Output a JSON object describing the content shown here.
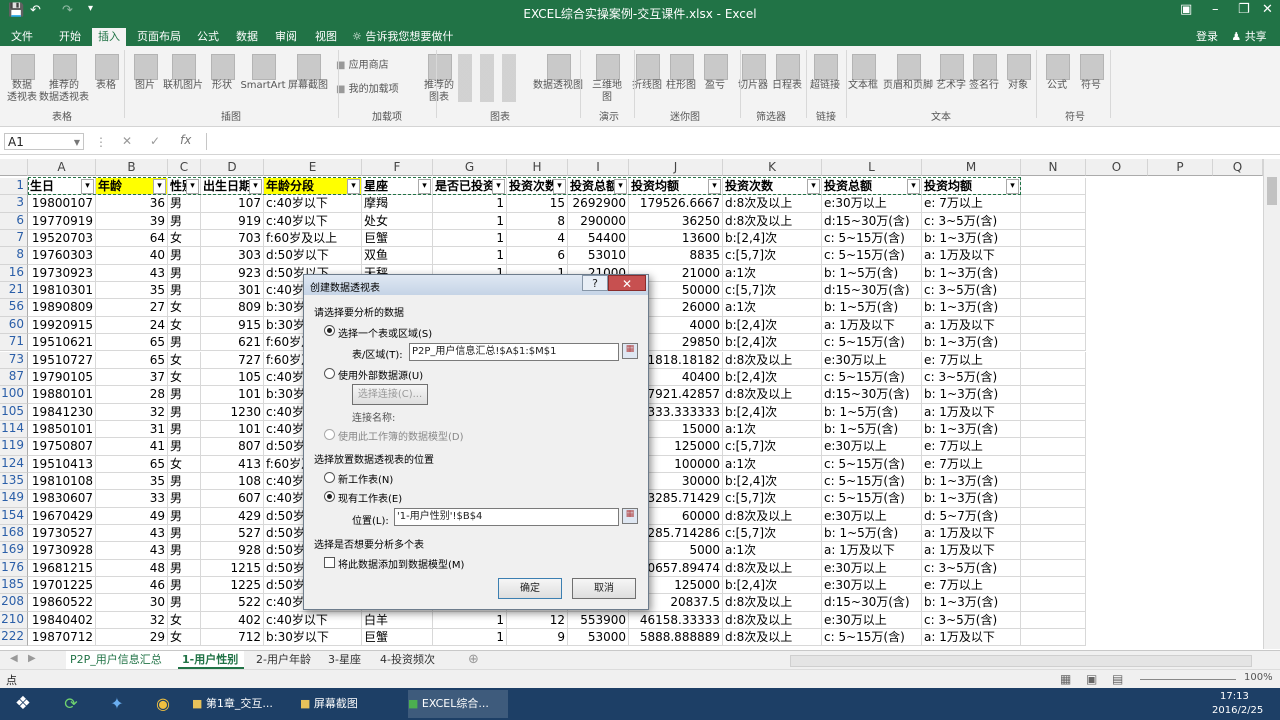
{
  "window": {
    "title": "EXCEL综合实操案例-交互课件.xlsx - Excel",
    "qat_save_icon": "save-icon",
    "qat_undo_icon": "undo-icon",
    "qat_redo_icon": "redo-icon"
  },
  "tabs": [
    "文件",
    "开始",
    "插入",
    "页面布局",
    "公式",
    "数据",
    "审阅",
    "视图"
  ],
  "active_tab": "插入",
  "tell_me": "告诉我您想要做什么...",
  "login": "登录",
  "share": "共享",
  "ribbon": {
    "buttons": [
      "数据\n透视表",
      "推荐的\n数据透视表",
      "表格",
      "图片",
      "联机图片",
      "形状",
      "SmartArt",
      "屏幕截图",
      "应用商店",
      "我的加载项",
      "推荐的\n图表",
      "数据透视图",
      "三维地\n图",
      "折线图",
      "柱形图",
      "盈亏",
      "切片器",
      "日程表",
      "超链接",
      "文本框",
      "页眉和页脚",
      "艺术字",
      "签名行",
      "对象",
      "公式",
      "符号"
    ],
    "groups": [
      "表格",
      "插图",
      "加载项",
      "图表",
      "演示",
      "迷你图",
      "筛选器",
      "链接",
      "文本",
      "符号"
    ]
  },
  "formula_bar": {
    "name_box": "A1",
    "fx": "fx",
    "value": ""
  },
  "columns": [
    "A",
    "B",
    "C",
    "D",
    "E",
    "F",
    "G",
    "H",
    "I",
    "J",
    "K",
    "L",
    "M",
    "N",
    "O",
    "P",
    "Q"
  ],
  "header_row": {
    "row": "1",
    "cells": [
      "生日",
      "年龄",
      "性别",
      "出生日期",
      "年龄分段",
      "星座",
      "是否已投资",
      "投资次数",
      "投资总额",
      "投资均额",
      "投资次数",
      "投资总额",
      "投资均额"
    ]
  },
  "rows": [
    {
      "row": "3",
      "cells": [
        "19800107",
        "36",
        "男",
        "107",
        "c:40岁以下",
        "摩羯",
        "1",
        "15",
        "2692900",
        "179526.6667",
        "d:8次及以上",
        "e:30万以上",
        "e: 7万以上"
      ]
    },
    {
      "row": "6",
      "cells": [
        "19770919",
        "39",
        "男",
        "919",
        "c:40岁以下",
        "处女",
        "1",
        "8",
        "290000",
        "36250",
        "d:8次及以上",
        "d:15~30万(含)",
        "c: 3~5万(含)"
      ]
    },
    {
      "row": "7",
      "cells": [
        "19520703",
        "64",
        "女",
        "703",
        "f:60岁及以上",
        "巨蟹",
        "1",
        "4",
        "54400",
        "13600",
        "b:[2,4]次",
        "c: 5~15万(含)",
        "b: 1~3万(含)"
      ]
    },
    {
      "row": "8",
      "cells": [
        "19760303",
        "40",
        "男",
        "303",
        "d:50岁以下",
        "双鱼",
        "1",
        "6",
        "53010",
        "8835",
        "c:[5,7]次",
        "c: 5~15万(含)",
        "a: 1万及以下"
      ]
    },
    {
      "row": "16",
      "cells": [
        "19730923",
        "43",
        "男",
        "923",
        "d:50岁以下",
        "天秤",
        "1",
        "1",
        "21000",
        "21000",
        "a:1次",
        "b: 1~5万(含)",
        "b: 1~3万(含)"
      ]
    },
    {
      "row": "21",
      "cells": [
        "19810301",
        "35",
        "男",
        "301",
        "c:40岁以下",
        "",
        "",
        "",
        "",
        "50000",
        "c:[5,7]次",
        "d:15~30万(含)",
        "c: 3~5万(含)"
      ]
    },
    {
      "row": "56",
      "cells": [
        "19890809",
        "27",
        "女",
        "809",
        "b:30岁以下",
        "",
        "",
        "",
        "",
        "26000",
        "a:1次",
        "b: 1~5万(含)",
        "b: 1~3万(含)"
      ]
    },
    {
      "row": "60",
      "cells": [
        "19920915",
        "24",
        "女",
        "915",
        "b:30岁以下",
        "",
        "",
        "",
        "",
        "4000",
        "b:[2,4]次",
        "a: 1万及以下",
        "a: 1万及以下"
      ]
    },
    {
      "row": "71",
      "cells": [
        "19510621",
        "65",
        "男",
        "621",
        "f:60岁及以上",
        "",
        "",
        "",
        "",
        "29850",
        "b:[2,4]次",
        "c: 5~15万(含)",
        "b: 1~3万(含)"
      ]
    },
    {
      "row": "73",
      "cells": [
        "19510727",
        "65",
        "女",
        "727",
        "f:60岁及以上",
        "",
        "",
        "",
        "",
        "81818.18182",
        "d:8次及以上",
        "e:30万以上",
        "e: 7万以上"
      ]
    },
    {
      "row": "87",
      "cells": [
        "19790105",
        "37",
        "女",
        "105",
        "c:40岁以下",
        "",
        "",
        "",
        "",
        "40400",
        "b:[2,4]次",
        "c: 5~15万(含)",
        "c: 3~5万(含)"
      ]
    },
    {
      "row": "100",
      "cells": [
        "19880101",
        "28",
        "男",
        "101",
        "b:30岁以下",
        "",
        "",
        "",
        "",
        "17921.42857",
        "d:8次及以上",
        "d:15~30万(含)",
        "b: 1~3万(含)"
      ]
    },
    {
      "row": "105",
      "cells": [
        "19841230",
        "32",
        "男",
        "1230",
        "c:40岁以下",
        "",
        "",
        "",
        "",
        "9333.333333",
        "b:[2,4]次",
        "b: 1~5万(含)",
        "a: 1万及以下"
      ]
    },
    {
      "row": "114",
      "cells": [
        "19850101",
        "31",
        "男",
        "101",
        "c:40岁以下",
        "",
        "",
        "",
        "",
        "15000",
        "a:1次",
        "b: 1~5万(含)",
        "b: 1~3万(含)"
      ]
    },
    {
      "row": "119",
      "cells": [
        "19750807",
        "41",
        "男",
        "807",
        "d:50岁以下",
        "",
        "",
        "",
        "",
        "125000",
        "c:[5,7]次",
        "e:30万以上",
        "e: 7万以上"
      ]
    },
    {
      "row": "124",
      "cells": [
        "19510413",
        "65",
        "女",
        "413",
        "f:60岁及以上",
        "",
        "",
        "",
        "",
        "100000",
        "a:1次",
        "c: 5~15万(含)",
        "e: 7万以上"
      ]
    },
    {
      "row": "135",
      "cells": [
        "19810108",
        "35",
        "男",
        "108",
        "c:40岁以下",
        "",
        "",
        "",
        "",
        "30000",
        "b:[2,4]次",
        "c: 5~15万(含)",
        "b: 1~3万(含)"
      ]
    },
    {
      "row": "149",
      "cells": [
        "19830607",
        "33",
        "男",
        "607",
        "c:40岁以下",
        "",
        "",
        "",
        "",
        "3285.71429",
        "c:[5,7]次",
        "c: 5~15万(含)",
        "b: 1~3万(含)"
      ]
    },
    {
      "row": "154",
      "cells": [
        "19670429",
        "49",
        "男",
        "429",
        "d:50岁以下",
        "",
        "",
        "",
        "",
        "60000",
        "d:8次及以上",
        "e:30万以上",
        "d: 5~7万(含)"
      ]
    },
    {
      "row": "168",
      "cells": [
        "19730527",
        "43",
        "男",
        "527",
        "d:50岁以下",
        "",
        "",
        "",
        "",
        "4285.714286",
        "c:[5,7]次",
        "b: 1~5万(含)",
        "a: 1万及以下"
      ]
    },
    {
      "row": "169",
      "cells": [
        "19730928",
        "43",
        "男",
        "928",
        "d:50岁以下",
        "",
        "",
        "",
        "",
        "5000",
        "a:1次",
        "a: 1万及以下",
        "a: 1万及以下"
      ]
    },
    {
      "row": "176",
      "cells": [
        "19681215",
        "48",
        "男",
        "1215",
        "d:50岁以下",
        "",
        "",
        "",
        "",
        "30657.89474",
        "d:8次及以上",
        "e:30万以上",
        "c: 3~5万(含)"
      ]
    },
    {
      "row": "185",
      "cells": [
        "19701225",
        "46",
        "男",
        "1225",
        "d:50岁以下",
        "",
        "",
        "",
        "",
        "125000",
        "b:[2,4]次",
        "e:30万以上",
        "e: 7万以上"
      ]
    },
    {
      "row": "208",
      "cells": [
        "19860522",
        "30",
        "男",
        "522",
        "c:40岁以下",
        "",
        "",
        "",
        "",
        "20837.5",
        "d:8次及以上",
        "d:15~30万(含)",
        "b: 1~3万(含)"
      ]
    },
    {
      "row": "210",
      "cells": [
        "19840402",
        "32",
        "女",
        "402",
        "c:40岁以下",
        "白羊",
        "1",
        "12",
        "553900",
        "46158.33333",
        "d:8次及以上",
        "e:30万以上",
        "c: 3~5万(含)"
      ]
    },
    {
      "row": "222",
      "cells": [
        "19870712",
        "29",
        "女",
        "712",
        "b:30岁以下",
        "巨蟹",
        "1",
        "9",
        "53000",
        "5888.888889",
        "d:8次及以上",
        "c: 5~15万(含)",
        "a: 1万及以下"
      ]
    }
  ],
  "dialog": {
    "title": "创建数据透视表",
    "section1": "请选择要分析的数据",
    "opt_table": "选择一个表或区域(S)",
    "range_label": "表/区域(T):",
    "range_value": "P2P_用户信息汇总!$A$1:$M$1",
    "opt_external": "使用外部数据源(U)",
    "choose_conn": "选择连接(C)...",
    "conn_name": "连接名称:",
    "opt_model": "使用此工作簿的数据模型(D)",
    "section2": "选择放置数据透视表的位置",
    "opt_new": "新工作表(N)",
    "opt_existing": "现有工作表(E)",
    "location_label": "位置(L):",
    "location_value": "'1-用户性别'!$B$4",
    "section3": "选择是否想要分析多个表",
    "add_model": "将此数据添加到数据模型(M)",
    "ok": "确定",
    "cancel": "取消"
  },
  "sheets": [
    "P2P_用户信息汇总",
    "1-用户性别",
    "2-用户年龄",
    "3-星座",
    "4-投资频次"
  ],
  "active_sheet": "1-用户性别",
  "status": {
    "mode": "点",
    "zoom": "100%"
  },
  "taskbar": {
    "items": [
      "第1章_交互...",
      "屏幕截图",
      "EXCEL综合..."
    ],
    "time": "17:13",
    "date": "2016/2/25"
  },
  "colors": {
    "excel_green": "#217346",
    "highlight_yellow": "#ffff00",
    "taskbar": "#1d3f66"
  }
}
